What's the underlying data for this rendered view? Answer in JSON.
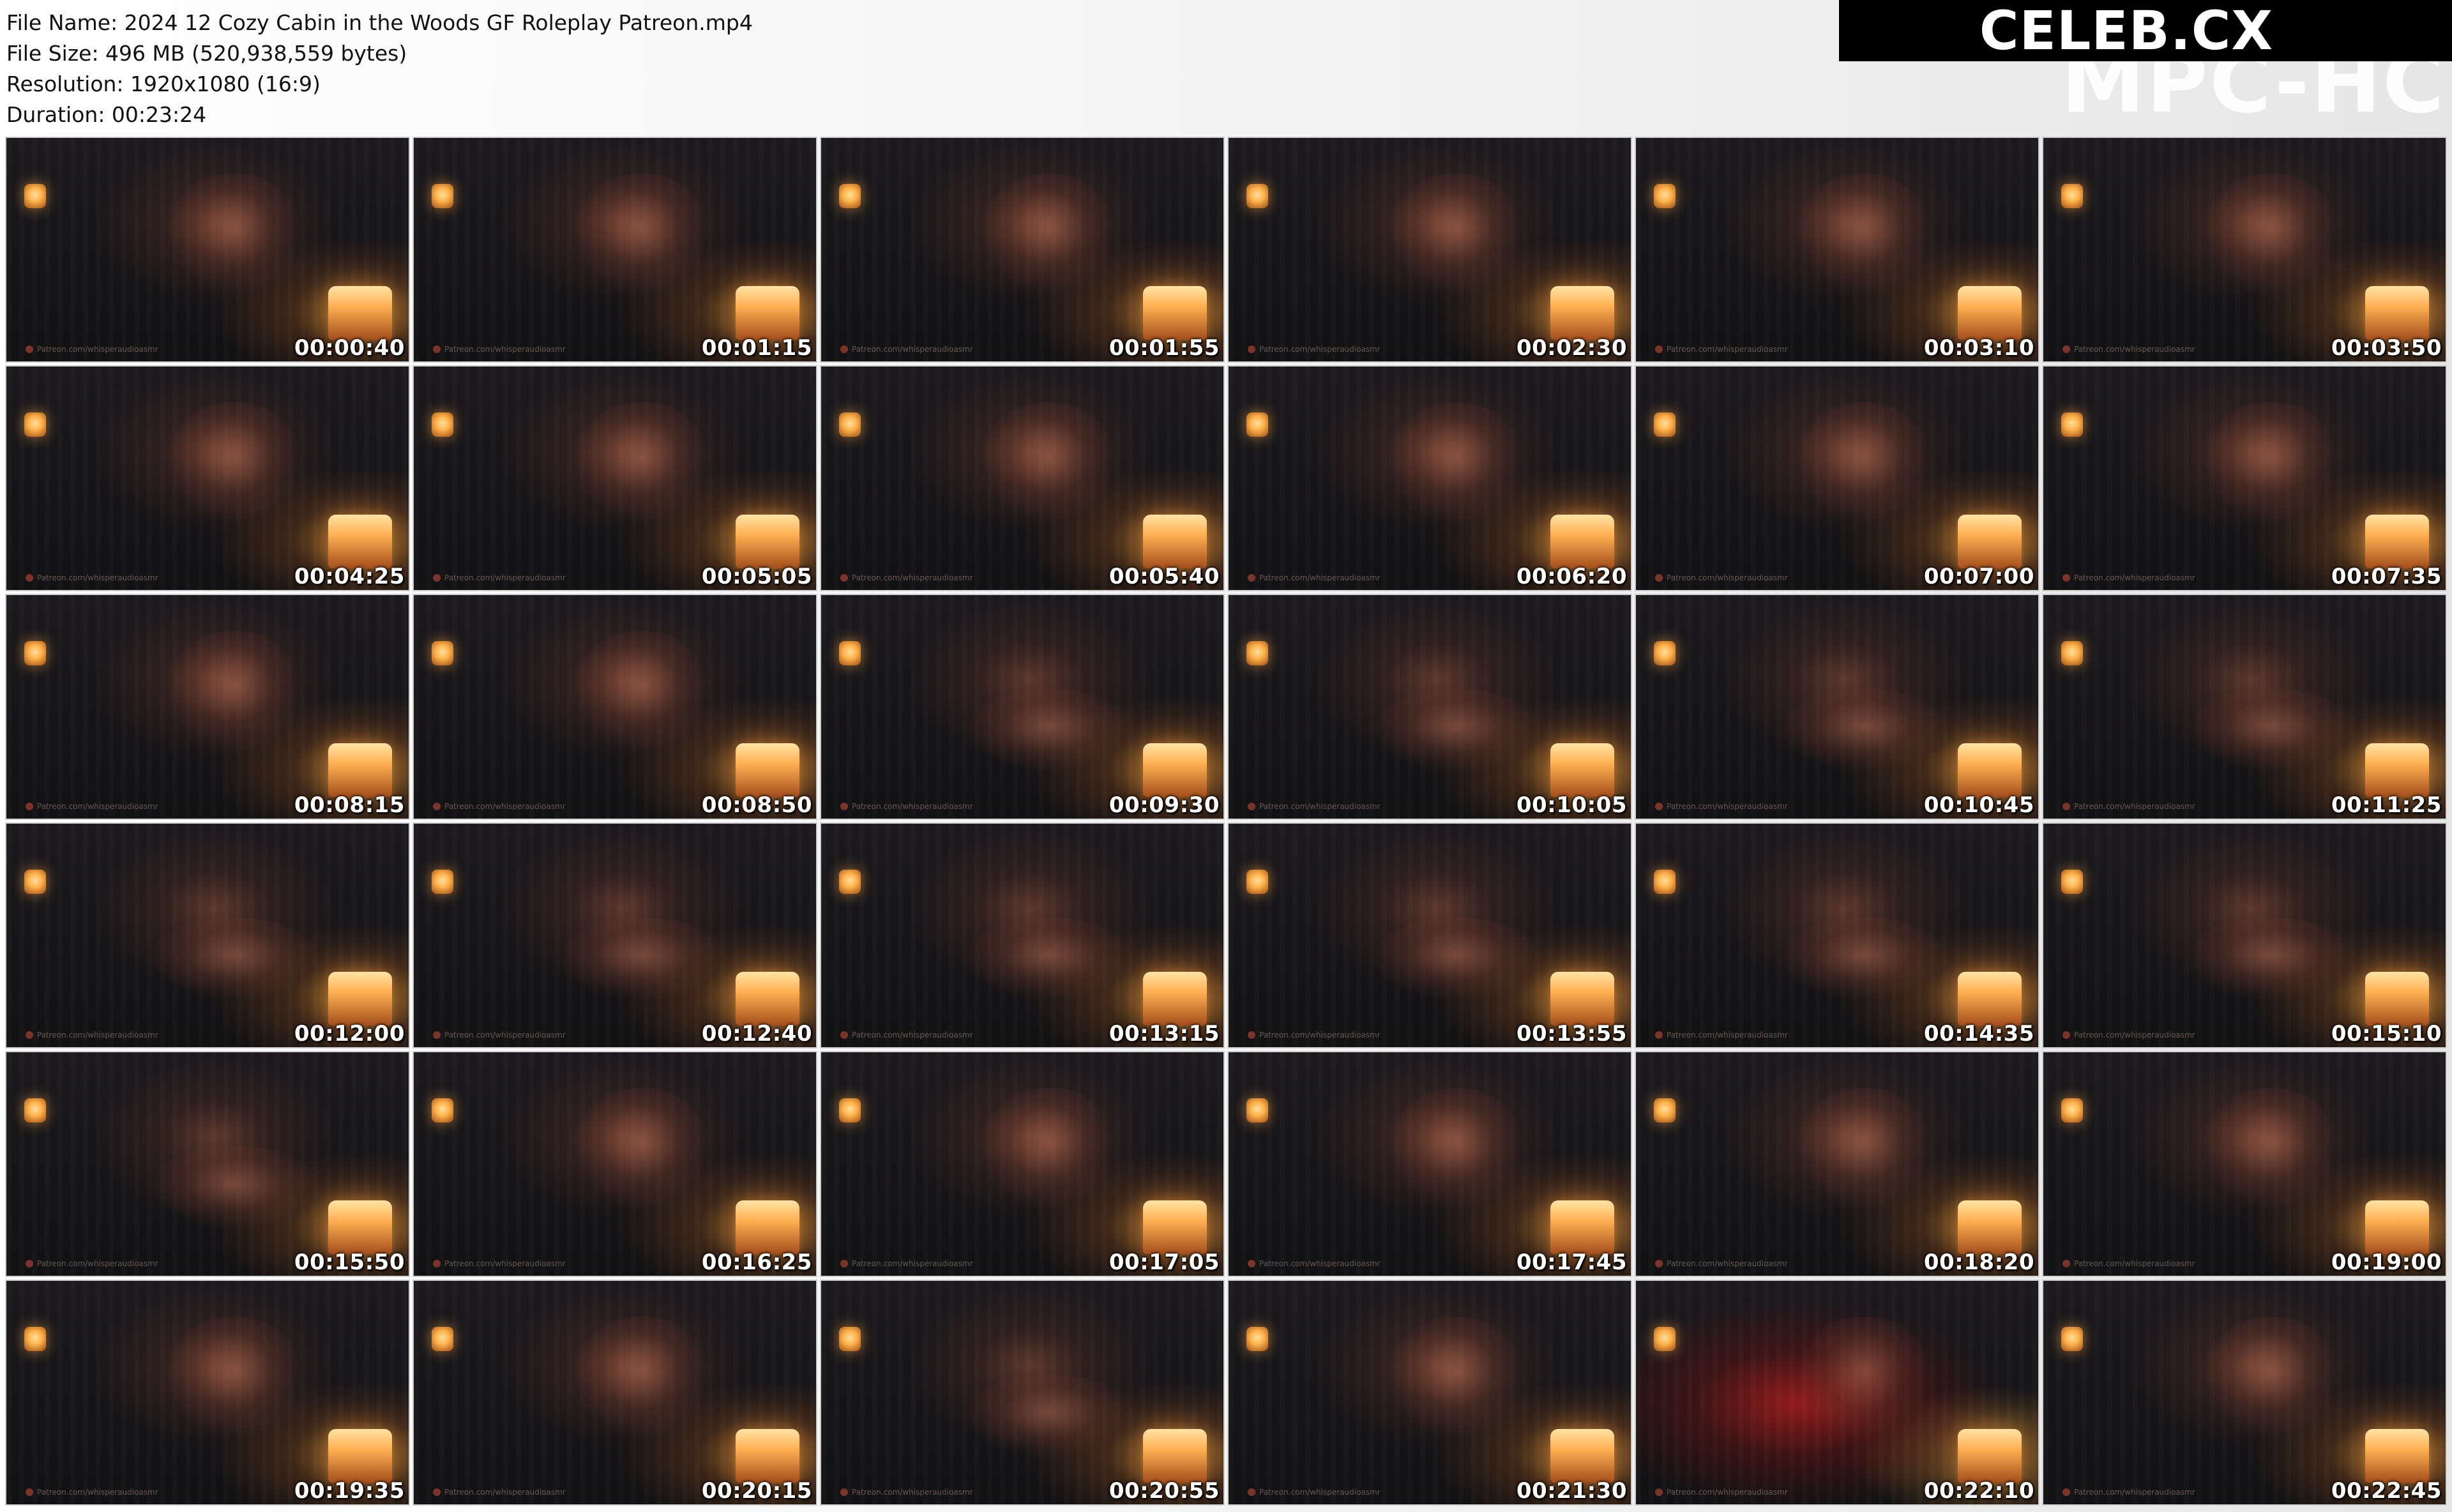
{
  "file_info": {
    "name": "File Name: 2024 12 Cozy Cabin in the Woods GF Roleplay Patreon.mp4",
    "size": "File Size: 496 MB (520,938,559 bytes)",
    "resolution": "Resolution: 1920x1080 (16:9)",
    "duration": "Duration: 00:23:24"
  },
  "brand": {
    "logo_text": "CELEB.CX",
    "watermark_text": "MPC-HC"
  },
  "thumbnail_watermark": "Patreon.com/whisperaudioasmr",
  "thumbnails": [
    {
      "time": "00:00:40",
      "scene": "reading"
    },
    {
      "time": "00:01:15",
      "scene": "reading"
    },
    {
      "time": "00:01:55",
      "scene": "closeup"
    },
    {
      "time": "00:02:30",
      "scene": "closeup"
    },
    {
      "time": "00:03:10",
      "scene": "closeup"
    },
    {
      "time": "00:03:50",
      "scene": "closeup"
    },
    {
      "time": "00:04:25",
      "scene": "closeup"
    },
    {
      "time": "00:05:05",
      "scene": "closeup"
    },
    {
      "time": "00:05:40",
      "scene": "closeup"
    },
    {
      "time": "00:06:20",
      "scene": "closeup"
    },
    {
      "time": "00:07:00",
      "scene": "closeup"
    },
    {
      "time": "00:07:35",
      "scene": "closeup"
    },
    {
      "time": "00:08:15",
      "scene": "closeup"
    },
    {
      "time": "00:08:50",
      "scene": "closeup"
    },
    {
      "time": "00:09:30",
      "scene": "lying"
    },
    {
      "time": "00:10:05",
      "scene": "lying"
    },
    {
      "time": "00:10:45",
      "scene": "lying"
    },
    {
      "time": "00:11:25",
      "scene": "lying"
    },
    {
      "time": "00:12:00",
      "scene": "lying"
    },
    {
      "time": "00:12:40",
      "scene": "lying"
    },
    {
      "time": "00:13:15",
      "scene": "lying"
    },
    {
      "time": "00:13:55",
      "scene": "lying"
    },
    {
      "time": "00:14:35",
      "scene": "lying"
    },
    {
      "time": "00:15:10",
      "scene": "lying"
    },
    {
      "time": "00:15:50",
      "scene": "lying"
    },
    {
      "time": "00:16:25",
      "scene": "closeup"
    },
    {
      "time": "00:17:05",
      "scene": "closeup"
    },
    {
      "time": "00:17:45",
      "scene": "closeup"
    },
    {
      "time": "00:18:20",
      "scene": "closeup"
    },
    {
      "time": "00:19:00",
      "scene": "closeup"
    },
    {
      "time": "00:19:35",
      "scene": "closeup"
    },
    {
      "time": "00:20:15",
      "scene": "closeup"
    },
    {
      "time": "00:20:55",
      "scene": "lying"
    },
    {
      "time": "00:21:30",
      "scene": "closeup"
    },
    {
      "time": "00:22:10",
      "scene": "red"
    },
    {
      "time": "00:22:45",
      "scene": "closeup"
    }
  ]
}
